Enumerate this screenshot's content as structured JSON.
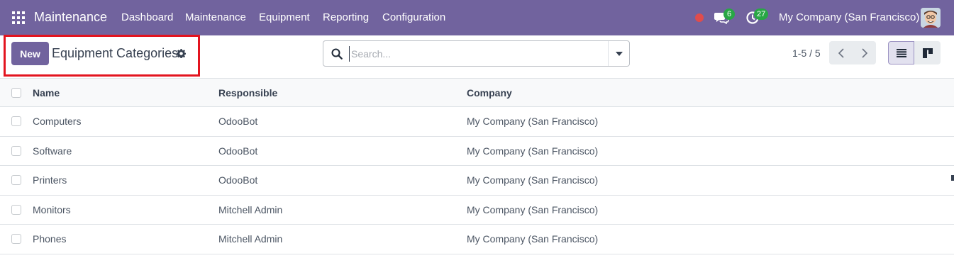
{
  "navbar": {
    "brand": "Maintenance",
    "menu": [
      "Dashboard",
      "Maintenance",
      "Equipment",
      "Reporting",
      "Configuration"
    ],
    "messages_count": "6",
    "activities_count": "27",
    "company": "My Company (San Francisco)",
    "color": "#71639e"
  },
  "control_panel": {
    "new_label": "New",
    "breadcrumb": "Equipment Categories",
    "search_placeholder": "Search...",
    "pager": "1-5 / 5"
  },
  "table": {
    "columns": [
      "Name",
      "Responsible",
      "Company"
    ],
    "rows": [
      {
        "name": "Computers",
        "responsible": "OdooBot",
        "company": "My Company (San Francisco)"
      },
      {
        "name": "Software",
        "responsible": "OdooBot",
        "company": "My Company (San Francisco)"
      },
      {
        "name": "Printers",
        "responsible": "OdooBot",
        "company": "My Company (San Francisco)"
      },
      {
        "name": "Monitors",
        "responsible": "Mitchell Admin",
        "company": "My Company (San Francisco)"
      },
      {
        "name": "Phones",
        "responsible": "Mitchell Admin",
        "company": "My Company (San Francisco)"
      }
    ]
  },
  "icons": {
    "apps": "apps-grid-icon",
    "chat": "chat-icon",
    "activity": "clock-icon",
    "settings": "gear-icon",
    "search": "search-icon",
    "list_view": "list-view-icon",
    "kanban_view": "kanban-view-icon"
  }
}
